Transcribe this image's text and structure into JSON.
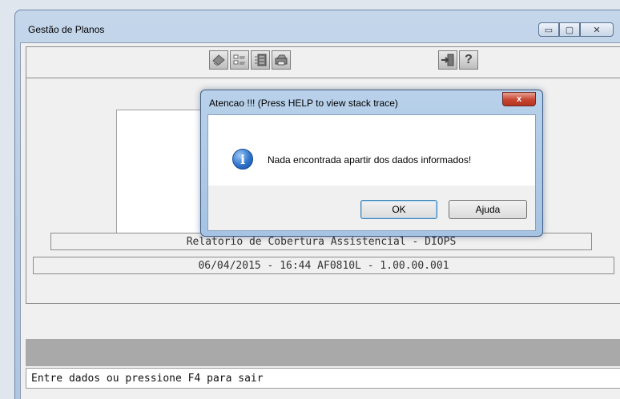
{
  "window": {
    "title": "Gestão de Planos",
    "controls": {
      "minimize": "▭",
      "maximize": "▢",
      "close": "✕"
    }
  },
  "toolbar": {
    "icons": [
      "eraser-icon",
      "checklist-icon",
      "form-icon",
      "printer-icon",
      "exit-door-icon",
      "help-question-icon"
    ],
    "help_glyph": "?"
  },
  "report": {
    "title": "Relatorio de Cobertura Assistencial - DIOPS",
    "info": "06/04/2015 - 16:44  AF0810L - 1.00.00.001"
  },
  "status": {
    "text": "Entre dados ou pressione F4 para sair"
  },
  "dialog": {
    "title": "Atencao !!!  (Press HELP to view stack trace)",
    "close_glyph": "x",
    "icon": "information-icon",
    "icon_glyph": "i",
    "message": "Nada encontrada apartir dos dados informados!",
    "ok_label": "OK",
    "help_label": "Ajuda"
  }
}
